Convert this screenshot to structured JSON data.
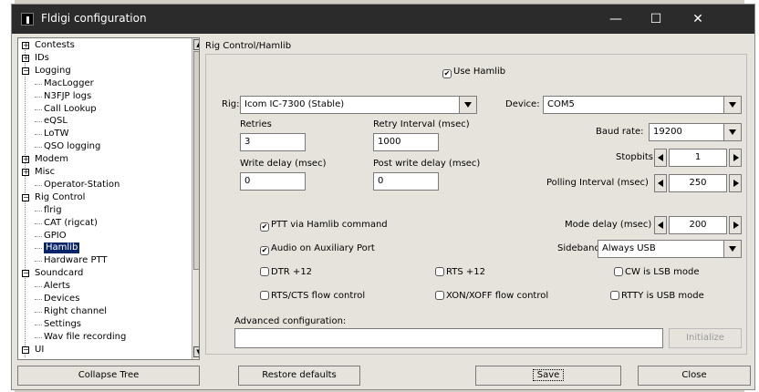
{
  "window": {
    "title": "Fldigi configuration",
    "minimize": "—",
    "maximize": "☐",
    "close": "✕"
  },
  "tree": {
    "items": [
      {
        "label": "Contests",
        "expander": "+"
      },
      {
        "label": "IDs",
        "expander": "+"
      },
      {
        "label": "Logging",
        "expander": "−"
      },
      {
        "label": "MacLogger"
      },
      {
        "label": "N3FJP logs"
      },
      {
        "label": "Call Lookup"
      },
      {
        "label": "eQSL"
      },
      {
        "label": "LoTW"
      },
      {
        "label": "QSO logging"
      },
      {
        "label": "Modem",
        "expander": "+"
      },
      {
        "label": "Misc",
        "expander": "+"
      },
      {
        "label": "Operator-Station"
      },
      {
        "label": "Rig Control",
        "expander": "−"
      },
      {
        "label": "flrig"
      },
      {
        "label": "CAT (rigcat)"
      },
      {
        "label": "GPIO"
      },
      {
        "label": "Hamlib",
        "selected": true
      },
      {
        "label": "Hardware PTT"
      },
      {
        "label": "Soundcard",
        "expander": "−"
      },
      {
        "label": "Alerts"
      },
      {
        "label": "Devices"
      },
      {
        "label": "Right channel"
      },
      {
        "label": "Settings"
      },
      {
        "label": "Wav file recording"
      },
      {
        "label": "UI",
        "expander": "−"
      }
    ],
    "scroll_up": "▲",
    "scroll_down": "▼"
  },
  "panel": {
    "title": "Rig Control/Hamlib",
    "use_hamlib": "Use Hamlib",
    "rig_label": "Rig:",
    "rig_value": "Icom IC-7300  (Stable)",
    "device_label": "Device:",
    "device_value": "COM5",
    "retries_label": "Retries",
    "retries_value": "3",
    "retry_interval_label": "Retry Interval (msec)",
    "retry_interval_value": "1000",
    "write_delay_label": "Write delay (msec)",
    "write_delay_value": "0",
    "post_write_delay_label": "Post write delay (msec)",
    "post_write_delay_value": "0",
    "baud_label": "Baud rate:",
    "baud_value": "19200",
    "stopbits_label": "Stopbits",
    "stopbits_value": "1",
    "polling_label": "Polling Interval (msec)",
    "polling_value": "250",
    "ptt_hamlib": "PTT via Hamlib command",
    "audio_aux": "Audio on Auxiliary Port",
    "mode_delay_label": "Mode delay (msec)",
    "mode_delay_value": "200",
    "sideband_label": "Sideband:",
    "sideband_value": "Always USB",
    "dtr": "DTR +12",
    "rts": "RTS +12",
    "cw_lsb": "CW is LSB mode",
    "rtscts": "RTS/CTS flow control",
    "xonxoff": "XON/XOFF flow control",
    "rtty_usb": "RTTY is USB mode",
    "advanced_label": "Advanced configuration:",
    "advanced_value": "",
    "initialize": "Initialize",
    "check_mark": "✔"
  },
  "footer": {
    "collapse_tree": "Collapse Tree",
    "restore_defaults": "Restore defaults",
    "save": "Save",
    "close": "Close"
  }
}
